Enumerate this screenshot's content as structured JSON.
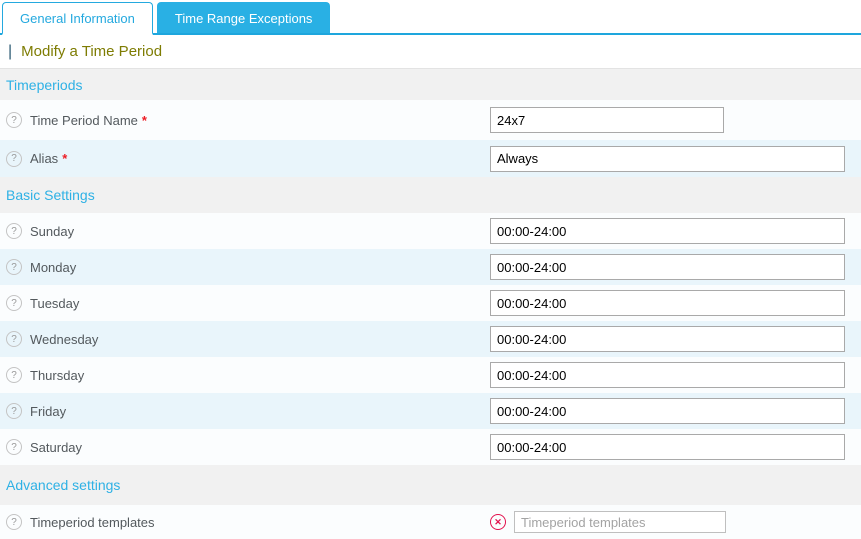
{
  "tabs": {
    "general": {
      "label": "General Information"
    },
    "exceptions": {
      "label": "Time Range Exceptions"
    }
  },
  "header": {
    "title_prefix": "|",
    "title": "Modify a Time Period"
  },
  "icons": {
    "help": "?",
    "clear": "✕"
  },
  "sections": {
    "timeperiods": {
      "title": "Timeperiods",
      "rows": {
        "name": {
          "label": "Time Period Name",
          "required": "*",
          "value": "24x7"
        },
        "alias": {
          "label": "Alias",
          "required": "*",
          "value": "Always"
        }
      }
    },
    "basic": {
      "title": "Basic Settings",
      "rows": {
        "sunday": {
          "label": "Sunday",
          "value": "00:00-24:00"
        },
        "monday": {
          "label": "Monday",
          "value": "00:00-24:00"
        },
        "tuesday": {
          "label": "Tuesday",
          "value": "00:00-24:00"
        },
        "wednesday": {
          "label": "Wednesday",
          "value": "00:00-24:00"
        },
        "thursday": {
          "label": "Thursday",
          "value": "00:00-24:00"
        },
        "friday": {
          "label": "Friday",
          "value": "00:00-24:00"
        },
        "saturday": {
          "label": "Saturday",
          "value": "00:00-24:00"
        }
      }
    },
    "advanced": {
      "title": "Advanced settings",
      "rows": {
        "templates": {
          "label": "Timeperiod templates",
          "placeholder": "Timeperiod templates"
        }
      }
    }
  },
  "colors": {
    "accent": "#24a9df",
    "inactive_tab_bg": "#29b0e4",
    "section_title": "#2eb1e5",
    "section_bg": "#f1f1f1",
    "row_light_bg": "#fbfdfe",
    "row_alt_bg": "#e9f5fb",
    "page_title": "#7e7c03",
    "required": "#ed1c24",
    "clear_icon": "#e2114d"
  }
}
